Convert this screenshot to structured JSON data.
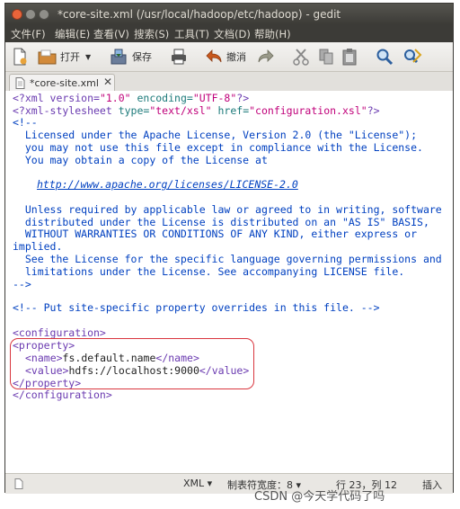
{
  "window": {
    "title": "*core-site.xml (/usr/local/hadoop/etc/hadoop) - gedit"
  },
  "menubar": {
    "file": "文件(F)",
    "edit": "编辑(E)",
    "view": "查看(V)",
    "search": "搜索(S)",
    "tools": "工具(T)",
    "documents": "文档(D)",
    "help": "帮助(H)"
  },
  "toolbar": {
    "open": "打开",
    "save": "保存",
    "undo": "撤消"
  },
  "tab": {
    "label": "*core-site.xml",
    "close": "✕"
  },
  "editor": {
    "l1": {
      "a": "<?xml version=",
      "b": "\"1.0\"",
      "c": " encoding=",
      "d": "\"UTF-8\"",
      "e": "?>"
    },
    "l2": {
      "a": "<?xml-stylesheet",
      "b": " type=",
      "c": "\"text/xsl\"",
      "d": " href=",
      "e": "\"configuration.xsl\"",
      "f": "?>"
    },
    "l3": "<!--",
    "l4": "  Licensed under the Apache License, Version 2.0 (the \"License\");",
    "l5": "  you may not use this file except in compliance with the License.",
    "l6": "  You may obtain a copy of the License at",
    "l7_link": "http://www.apache.org/licenses/LICENSE-2.0",
    "l8": "  Unless required by applicable law or agreed to in writing, software",
    "l9": "  distributed under the License is distributed on an \"AS IS\" BASIS,",
    "l10": "  WITHOUT WARRANTIES OR CONDITIONS OF ANY KIND, either express or",
    "l11": "implied.",
    "l12": "  See the License for the specific language governing permissions and",
    "l13": "  limitations under the License. See accompanying LICENSE file.",
    "l14": "-->",
    "l15": "<!-- Put site-specific property overrides in this file. -->",
    "l16": "<configuration>",
    "l17": "<property>",
    "l18": {
      "open": "<name>",
      "text": "fs.default.name",
      "close": "</name>"
    },
    "l19": {
      "open": "<value>",
      "text": "hdfs://localhost:9000",
      "close": "</value>"
    },
    "l20": "</property>",
    "l21": "</configuration>"
  },
  "statusbar": {
    "language": "XML ▾",
    "tab_width": "制表符宽度：8 ▾",
    "position": "行 23，列 12",
    "mode": "插入"
  },
  "watermark": "CSDN @今天学代码了吗",
  "colors": {
    "highlight_box": "#d9363e",
    "close_button": "#e9643a",
    "titlebar": "#3c3b37"
  }
}
